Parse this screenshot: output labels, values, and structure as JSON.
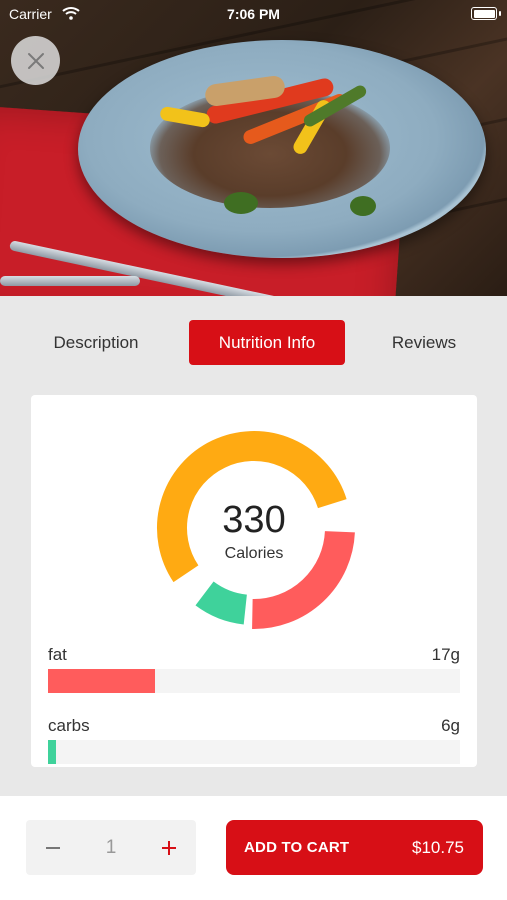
{
  "status_bar": {
    "carrier": "Carrier",
    "time": "7:06 PM"
  },
  "hero": {
    "icon": "close-icon"
  },
  "tabs": [
    {
      "label": "Description",
      "active": false
    },
    {
      "label": "Nutrition Info",
      "active": true
    },
    {
      "label": "Reviews",
      "active": false
    }
  ],
  "nutrition": {
    "calories": "330",
    "calories_label": "Calories",
    "chart_segments": [
      {
        "color": "#ffaa12",
        "fraction": 0.56
      },
      {
        "color": "#ff5c5c",
        "fraction": 0.26
      },
      {
        "color": "#3fd29b",
        "fraction": 0.1
      }
    ],
    "nutrients": [
      {
        "name": "fat",
        "amount": "17g",
        "level": 0.26,
        "color": "#ff5c5c"
      },
      {
        "name": "carbs",
        "amount": "6g",
        "level": 0.02,
        "color": "#3fd29b"
      }
    ]
  },
  "bottom_bar": {
    "quantity": "1",
    "add_to_cart_label": "ADD TO CART",
    "price": "$10.75"
  },
  "colors": {
    "brand_red": "#d70f16",
    "background": "#e8e8e8"
  }
}
